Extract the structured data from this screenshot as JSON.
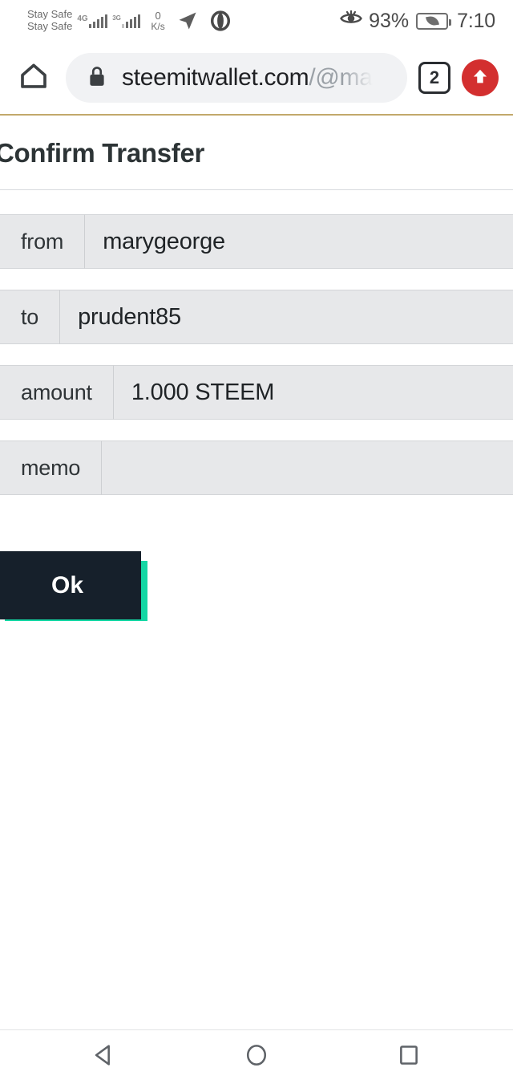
{
  "status_bar": {
    "carrier_primary": "Stay Safe",
    "carrier_secondary": "Stay Safe",
    "network_primary": "4G",
    "network_secondary": "3G",
    "data_speed_value": "0",
    "data_speed_unit": "K/s",
    "location_icon": "location-arrow-icon",
    "opera_icon": "opera-icon",
    "eye_comfort_icon": "eye-comfort-icon",
    "battery_percent": "93%",
    "battery_mode_icon": "power-saving-leaf-icon",
    "time": "7:10"
  },
  "browser": {
    "home_icon": "home-icon",
    "lock_icon": "lock-icon",
    "url_domain": "steemitwallet.com",
    "url_path": "/@ma",
    "url_full": "steemitwallet.com/@ma",
    "tab_count": "2",
    "upload_icon": "upload-arrow-icon"
  },
  "page": {
    "title": "Confirm Transfer",
    "rows": [
      {
        "label": "from",
        "value": "marygeorge"
      },
      {
        "label": "to",
        "value": "prudent85"
      },
      {
        "label": "amount",
        "value": "1.000 STEEM"
      },
      {
        "label": "memo",
        "value": ""
      }
    ],
    "confirm_button": "Ok"
  },
  "nav_bar": {
    "back": "back-triangle-icon",
    "home": "home-circle-icon",
    "recents": "recents-square-icon"
  },
  "colors": {
    "accent_teal": "#14d7a4",
    "button_dark": "#16202b",
    "upload_red": "#d32f2f",
    "row_grey": "#e7e8ea",
    "gold_rule": "#c2a96b"
  }
}
